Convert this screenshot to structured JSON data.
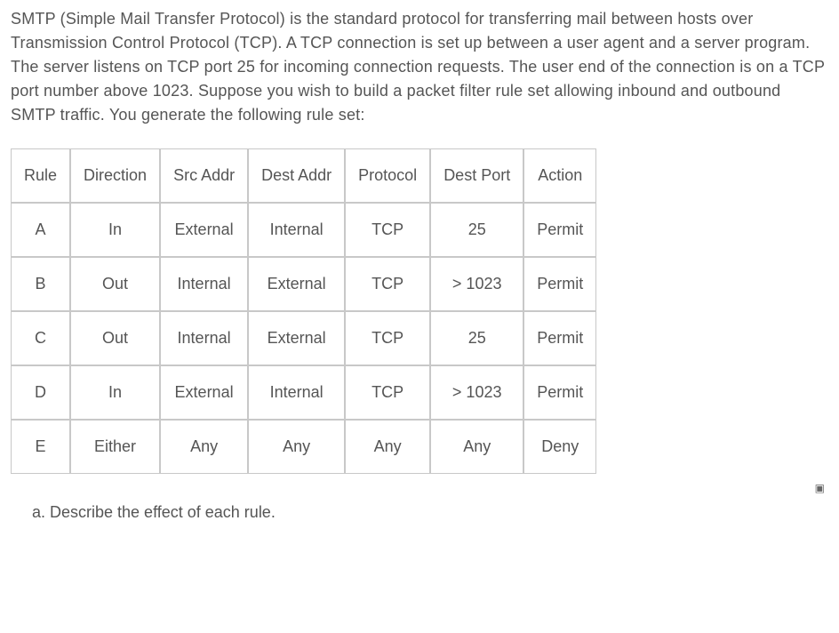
{
  "intro": "SMTP (Simple Mail Transfer Protocol) is the standard protocol for transferring mail between hosts over Transmission Control Protocol (TCP). A TCP connection is set up between a user agent and a server program. The server listens on TCP port 25 for incoming connection requests. The user end of the connection is on a TCP port number above 1023. Suppose you wish to build a packet filter rule set allowing inbound and outbound SMTP traffic. You generate the following rule set:",
  "table": {
    "headers": [
      "Rule",
      "Direction",
      "Src Addr",
      "Dest Addr",
      "Protocol",
      "Dest Port",
      "Action"
    ],
    "rows": [
      [
        "A",
        "In",
        "External",
        "Internal",
        "TCP",
        "25",
        "Permit"
      ],
      [
        "B",
        "Out",
        "Internal",
        "External",
        "TCP",
        "> 1023",
        "Permit"
      ],
      [
        "C",
        "Out",
        "Internal",
        "External",
        "TCP",
        "25",
        "Permit"
      ],
      [
        "D",
        "In",
        "External",
        "Internal",
        "TCP",
        "> 1023",
        "Permit"
      ],
      [
        "E",
        "Either",
        "Any",
        "Any",
        "Any",
        "Any",
        "Deny"
      ]
    ]
  },
  "question_label": "a. Describe the effect of each rule.",
  "side_glyph": "▣"
}
